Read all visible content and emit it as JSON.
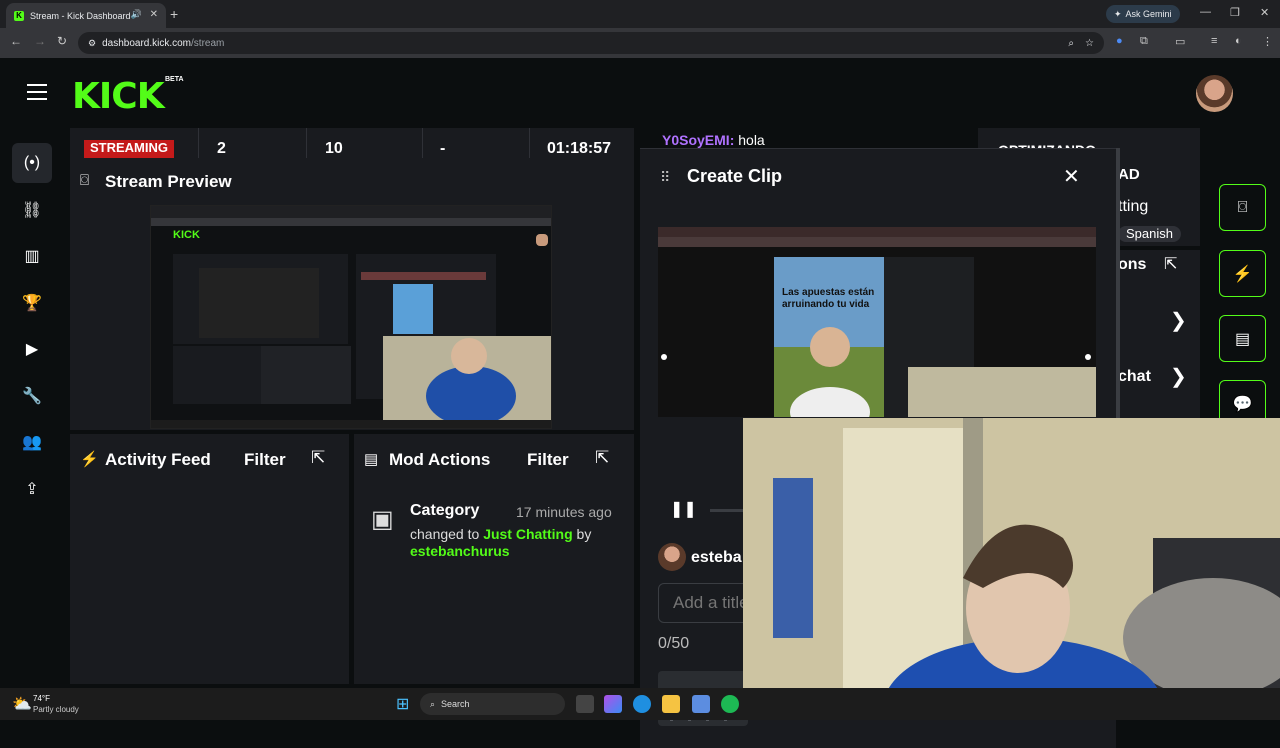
{
  "browser": {
    "tab_title": "Stream - Kick Dashboard",
    "favicon_letter": "K",
    "gemini_label": "Ask Gemini",
    "url_host": "dashboard.kick.com",
    "url_path": "/stream"
  },
  "app": {
    "logo": "KICK",
    "beta": "BETA"
  },
  "stats": {
    "status": "STREAMING",
    "viewers": "2",
    "followers": "10",
    "dash": "-",
    "uptime": "01:18:57"
  },
  "stream_preview": {
    "title": "Stream Preview"
  },
  "activity_feed": {
    "title": "Activity Feed",
    "filter": "Filter"
  },
  "mod_actions": {
    "title": "Mod Actions",
    "filter": "Filter",
    "entry": {
      "label": "Category",
      "time": "17 minutes ago",
      "changed_to": "changed to",
      "category": "Just Chatting",
      "by": "by",
      "user": "estebanchurus"
    }
  },
  "chat": {
    "user": "Y0SoyEMI:",
    "message": "hola"
  },
  "create_clip": {
    "title": "Create Clip",
    "video_caption": "Las apuestas están arruinando tu vida",
    "username": "esteba",
    "title_placeholder": "Add a title",
    "counter": "0/50"
  },
  "right_panel": {
    "optimizando": "OPTIMIZANDO",
    "ad": "AD",
    "tting": "tting",
    "spanish": "Spanish",
    "ons": "ons",
    "chat": "chat"
  },
  "taskbar": {
    "temp": "74°F",
    "weather": "Partly cloudy",
    "search": "Search"
  },
  "colors": {
    "brand": "#53fc18",
    "streaming": "#c41a1a",
    "chat_user": "#b072ff"
  }
}
